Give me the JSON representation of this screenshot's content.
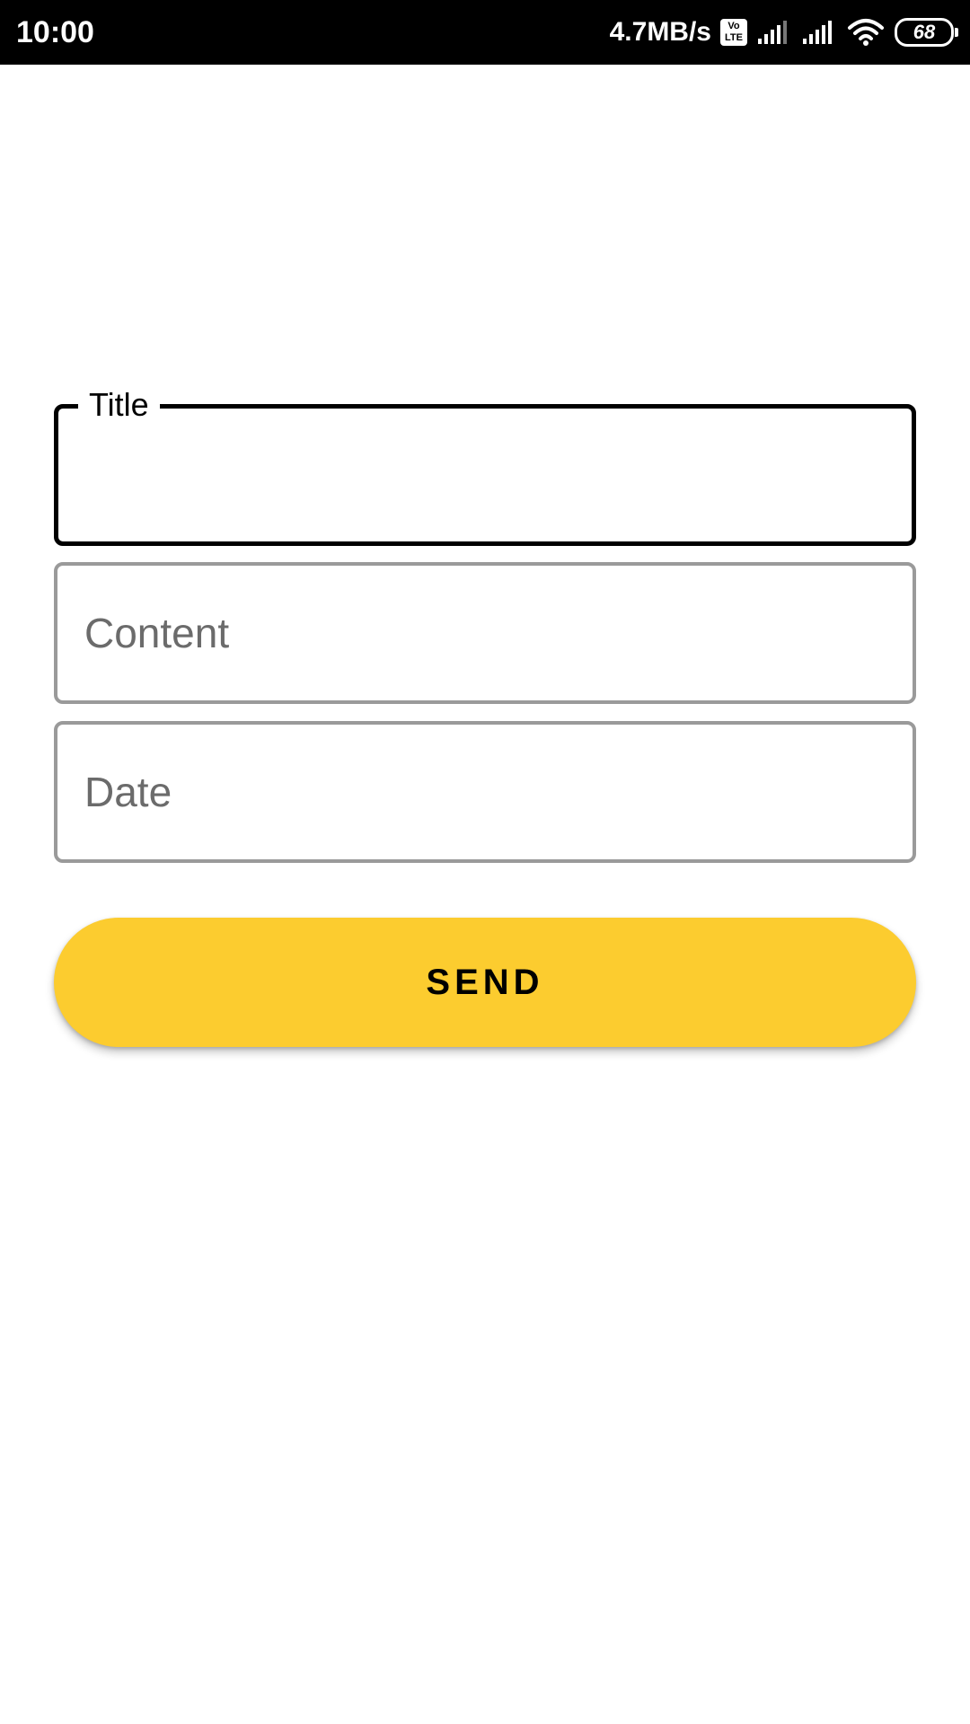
{
  "status_bar": {
    "time": "10:00",
    "network_speed": "4.7MB/s",
    "volte_top": "Vo",
    "volte_bottom": "LTE",
    "battery_level": "68",
    "icons": [
      "volte-icon",
      "signal-icon",
      "signal-icon",
      "wifi-icon",
      "battery-icon"
    ]
  },
  "form": {
    "title": {
      "label": "Title",
      "value": ""
    },
    "content": {
      "placeholder": "Content",
      "value": ""
    },
    "date": {
      "placeholder": "Date",
      "value": ""
    },
    "send_label": "SEND"
  },
  "colors": {
    "status_bar_bg": "#000000",
    "focused_border": "#000000",
    "idle_border": "#9a9a9a",
    "placeholder": "#6b6b6b",
    "button_accent": "#fccc2f"
  }
}
